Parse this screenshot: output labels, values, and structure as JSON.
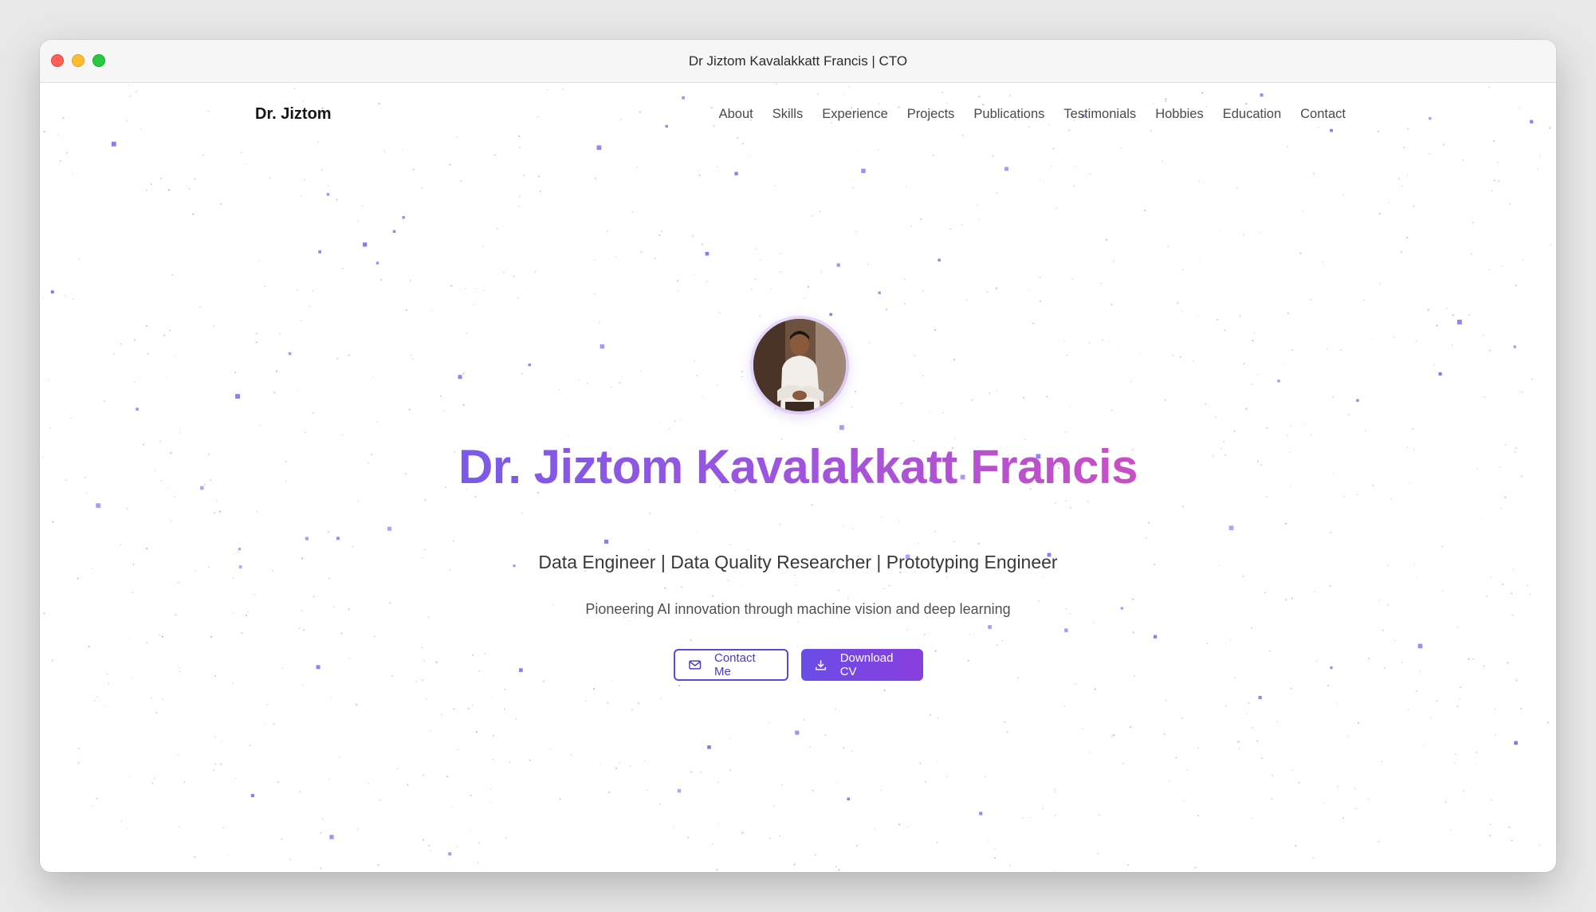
{
  "window": {
    "title": "Dr Jiztom Kavalakkatt Francis | CTO"
  },
  "nav": {
    "brand": "Dr. Jiztom",
    "links": [
      "About",
      "Skills",
      "Experience",
      "Projects",
      "Publications",
      "Testimonials",
      "Hobbies",
      "Education",
      "Contact"
    ]
  },
  "hero": {
    "name": "Dr. Jiztom Kavalakkatt Francis",
    "roles": "Data Engineer | Data Quality Researcher | Prototyping Engineer",
    "tagline": "Pioneering AI innovation through machine vision and deep learning",
    "avatar_icon": "profile-photo",
    "buttons": {
      "contact_label": "Contact Me",
      "contact_icon": "mail-icon",
      "download_label": "Download CV",
      "download_icon": "download-icon"
    }
  },
  "colors": {
    "accent": "#6a4de6",
    "gradient_start": "#7a5ae8",
    "gradient_end": "#c94fc4",
    "particle": "#7b6ff0"
  }
}
